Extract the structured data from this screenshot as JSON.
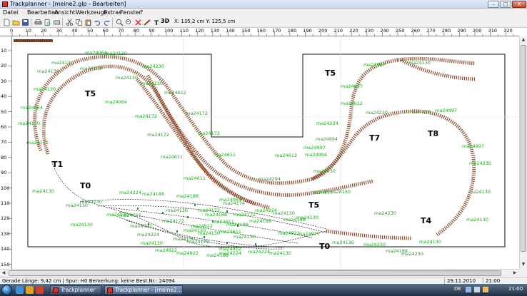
{
  "window": {
    "title": "Trackplanner - [meine2.glp - Bearbeiten]",
    "min_glyph": "–",
    "max_glyph": "□",
    "close_glyph": "X"
  },
  "menu": [
    "Datei",
    "Bearbeiten",
    "Ansicht",
    "Werkzeuge",
    "Extras",
    "Fenster",
    "?"
  ],
  "toolbar": {
    "icons": [
      "new-file-icon",
      "open-folder-icon",
      "save-icon",
      "print-icon",
      "print-preview-icon",
      "undo-icon",
      "redo-icon",
      "copy-icon",
      "paste-icon",
      "delete-icon",
      "track-tool-icon",
      "text-tool-icon"
    ],
    "view_3d_label": "3D",
    "coords_label": "X: 135,2 cm  Y: 125,5 cm"
  },
  "ruler": {
    "top": [
      "0",
      "10",
      "20",
      "30",
      "40",
      "50",
      "60",
      "70",
      "80",
      "90",
      "100",
      "110",
      "120",
      "130",
      "140",
      "150",
      "160",
      "170",
      "180",
      "190",
      "200",
      "210",
      "220",
      "230",
      "240",
      "250",
      "260",
      "270",
      "280",
      "290",
      "300",
      "310",
      "320"
    ],
    "left": [
      "10",
      "20",
      "30",
      "40",
      "50",
      "60",
      "70",
      "80",
      "90",
      "100",
      "110",
      "120",
      "130",
      "140",
      "150"
    ]
  },
  "layout": {
    "track_names": [
      "T5",
      "T5",
      "T5",
      "T1",
      "T0",
      "T0",
      "T7",
      "T8",
      "T4"
    ],
    "part_labels": [
      "ma24064",
      "ma24130",
      "ma24130",
      "ma24230",
      "ma24130",
      "ma24130",
      "ma24130",
      "ma24130",
      "ma24064",
      "ma24130",
      "ma24172",
      "ma24612",
      "ma24172",
      "ma24172",
      "ma24172",
      "ma24064",
      "ma24172",
      "ma24130",
      "ma24130",
      "ma24611",
      "ma24612",
      "ma24611",
      "ma24611",
      "ma24294",
      "ma24130",
      "ma24224",
      "ma24188",
      "ma24188",
      "ma24172",
      "ma24064",
      "ma24977",
      "ma24130",
      "ma24130",
      "ma24130",
      "ma24224",
      "ma24130",
      "ma24188",
      "ma24174",
      "ma24188",
      "ma24611",
      "ma24922",
      "ma24172",
      "ma24922",
      "ma24172",
      "ma24188",
      "ma24224",
      "ma24922",
      "ma24130",
      "ma24188",
      "ma24922",
      "ma24922",
      "ma24130",
      "ma24172",
      "ma24224",
      "ma24130",
      "ma24188",
      "ma24130",
      "ma24611",
      "ma24130",
      "ma24130",
      "ma24611",
      "ma24130",
      "ma24922",
      "ma24977",
      "ma24224",
      "ma24130",
      "ma24130",
      "ma24230",
      "ma24230",
      "ma24130",
      "ma24130",
      "ma24230",
      "ma24997",
      "ma24997",
      "ma24230",
      "ma24130",
      "ma24130",
      "ma24130",
      "ma24188",
      "ma24230",
      "ma24230",
      "ma24994",
      "ma24994",
      "ma24997",
      "ma24612",
      "ma24224",
      "ma24997",
      "ma24997",
      "ma24130"
    ],
    "wood_color": "#8b4a2b",
    "sleeper_color": "#4a2c1a",
    "rail_color": "#6b5e55",
    "label_color": "#22a322"
  },
  "status": {
    "main": "Gerade  Länge: 9,42 cm | Spur: H0 Bemerkung: keine  Best.Nr.: 24094",
    "date": "29.11.2010",
    "time": "21:00"
  },
  "taskbar": {
    "task1": "Trackplanner",
    "task2": "Trackplanner - [meine2...",
    "lang": "DE",
    "clock": "21:00"
  }
}
